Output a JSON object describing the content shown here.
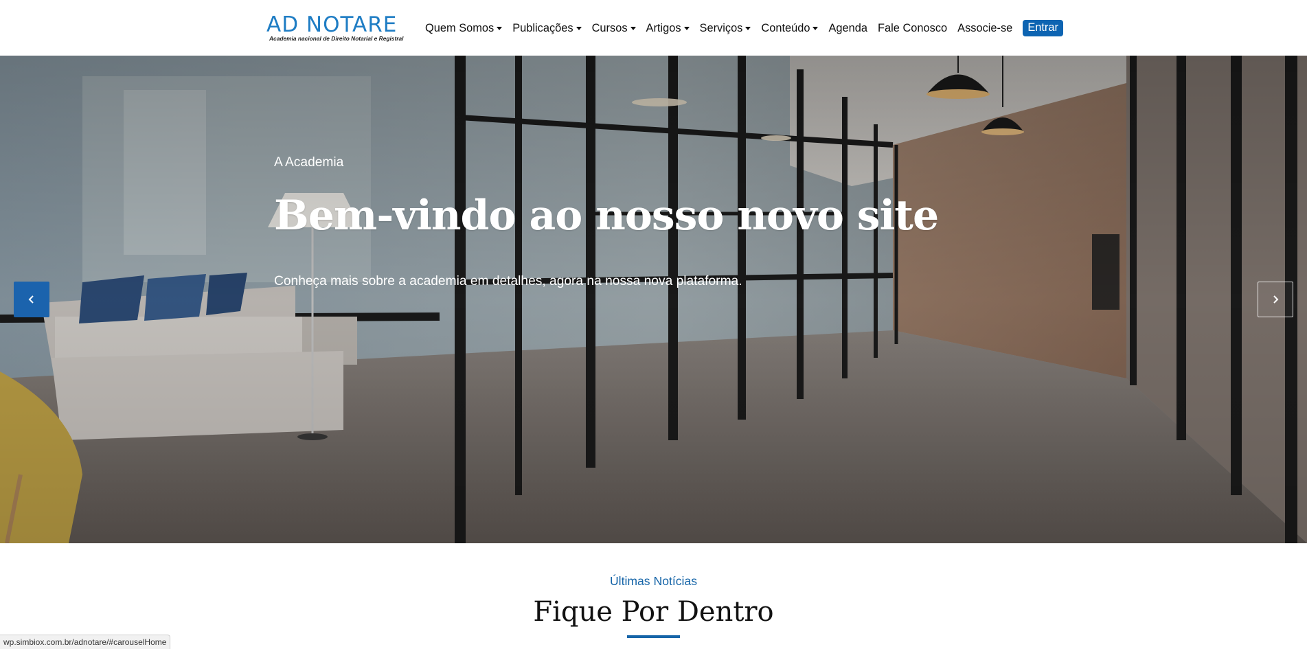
{
  "brand": {
    "name": "AD NOTARE",
    "tagline": "Academia nacional de Direito Notarial e Registral",
    "color": "#1f7dc4"
  },
  "nav": {
    "items": [
      {
        "label": "Quem Somos",
        "dropdown": true
      },
      {
        "label": "Publicações",
        "dropdown": true
      },
      {
        "label": "Cursos",
        "dropdown": true
      },
      {
        "label": "Artigos",
        "dropdown": true
      },
      {
        "label": "Serviços",
        "dropdown": true
      },
      {
        "label": "Conteúdo",
        "dropdown": true
      },
      {
        "label": "Agenda",
        "dropdown": false
      },
      {
        "label": "Fale Conosco",
        "dropdown": false
      },
      {
        "label": "Associe-se",
        "dropdown": false
      }
    ],
    "cta_label": "Entrar",
    "cta_color": "#0d64b2"
  },
  "hero": {
    "eyebrow": "A Academia",
    "title": "Bem-vindo ao nosso novo site",
    "text": "Conheça mais sobre a academia em detalhes, agora na nossa nova plataforma.",
    "prev_icon": "chevron-left-icon",
    "next_icon": "chevron-right-icon",
    "background": "office-corridor-glass-walls-photo"
  },
  "news": {
    "eyebrow": "Últimas Notícias",
    "title": "Fique Por Dentro",
    "accent_color": "#1665a8"
  },
  "statusbar": {
    "url": "wp.simbiox.com.br/adnotare/#carouselHome"
  }
}
